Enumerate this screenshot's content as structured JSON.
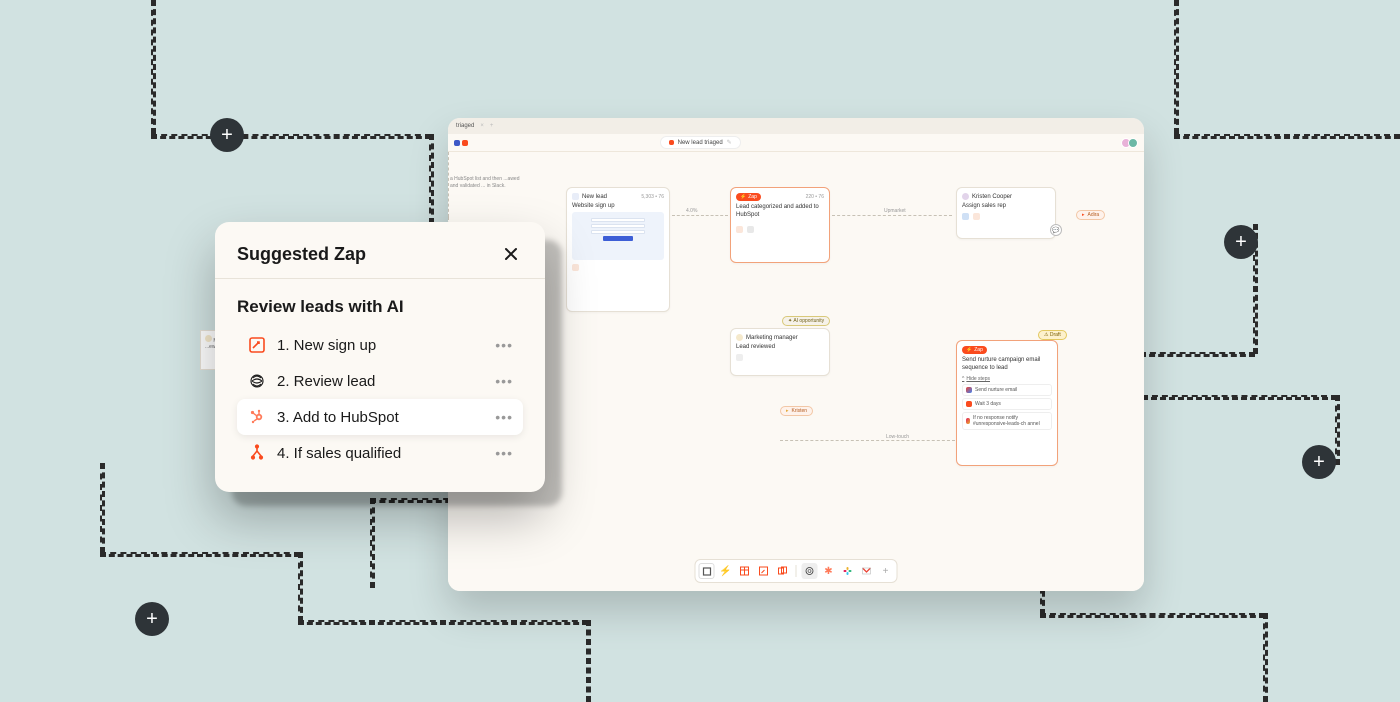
{
  "browser": {
    "tab_name": "triaged",
    "title": "New lead triaged"
  },
  "canvas": {
    "top_note": "a HubSpot list and then\n...awed and validated\n... in Slack.",
    "card_newlead": {
      "title": "New lead",
      "meta": "5,303 • 76",
      "body": "Website sign up"
    },
    "arrow_ab": "4.0%",
    "card_zap1": {
      "title": "Zap",
      "meta": "220 • 76",
      "body": "Lead categorized and added to HubSpot"
    },
    "arrow_bc": "Upmarket",
    "card_assign": {
      "owner": "Kristen Cooper",
      "body": "Assign sales rep"
    },
    "pill_adira": "Adira",
    "pill_ai": "AI opportunity",
    "card_review": {
      "owner": "Marketing manager",
      "body": "Lead reviewed"
    },
    "pill_kristen": "Kristen",
    "arrow_low": "Low-touch",
    "pill_draft": "Draft",
    "card_nurture": {
      "title": "Zap",
      "body": "Send nurture campaign email sequence to lead",
      "hide": "Hide steps",
      "steps": [
        "Send nurture email",
        "Wait 3 days",
        "If no response notify #unresponsive-leads-ch annel"
      ]
    },
    "partial_card": {
      "owner": "Marketing manager",
      "body": "...ew lead"
    }
  },
  "dock": {
    "tools": [
      "square",
      "zap",
      "table",
      "card",
      "cards",
      "openai",
      "hubspot",
      "slack",
      "gmail",
      "add"
    ]
  },
  "dialog": {
    "title": "Suggested Zap",
    "subtitle": "Review leads with AI",
    "steps": [
      {
        "label": "1. New sign up",
        "icon": "interfaces"
      },
      {
        "label": "2. Review lead",
        "icon": "openai"
      },
      {
        "label": "3. Add to HubSpot",
        "icon": "hubspot"
      },
      {
        "label": "4. If sales qualified",
        "icon": "paths"
      }
    ]
  }
}
